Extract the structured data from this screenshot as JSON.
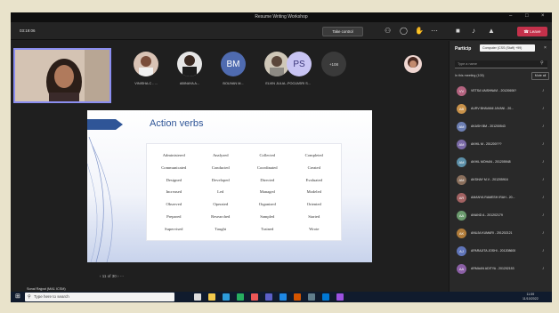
{
  "window": {
    "title": "Resume Writing Workshop"
  },
  "toolbar": {
    "timer": "03:19:06",
    "take_control_label": "Take control",
    "leave_label": "Leave"
  },
  "participants_strip": [
    {
      "initials": "",
      "name": "VINISHA.C - ..."
    },
    {
      "initials": "",
      "name": "ABINAYA A..."
    },
    {
      "initials": "BM",
      "name": "BOUVAN M..."
    },
    {
      "initials": "",
      "name": "ELVIN JULIA..."
    },
    {
      "initials": "PS",
      "name": "POOJASRI S..."
    }
  ],
  "more_count": "+108",
  "slide": {
    "title": "Action verbs",
    "verbs": [
      "Administered",
      "Analyzed",
      "Collected",
      "Completed",
      "Communicated",
      "Conducted",
      "Coordinated",
      "Created",
      "Designed",
      "Developed",
      "Directed",
      "Evaluated",
      "Increased",
      "Led",
      "Managed",
      "Modeled",
      "Observed",
      "Operated",
      "Organized",
      "Oriented",
      "Prepared",
      "Researched",
      "Sampled",
      "Started",
      "Supervised",
      "Taught",
      "Trained",
      "Wrote"
    ],
    "nav": "11 of 30"
  },
  "presenter": "Sonal Rajput (MA1 ICSM)",
  "panel": {
    "title": "Particip",
    "tooltip": "Computer (CSS (Staff) +99)",
    "search_placeholder": "Type a name",
    "section_label": "In this meeting (105)",
    "mute_all_label": "Mute all",
    "people": [
      {
        "initials": "VV",
        "name": "VETSA VAISHNAVI - 20120606?",
        "color": "#b3637f"
      },
      {
        "initials": "AB",
        "name": "AURV BHAVANI JAYANI - 20...",
        "color": "#c9924a"
      },
      {
        "initials": "AM",
        "name": "AKASH BM - 201200543",
        "color": "#6d7fb3"
      },
      {
        "initials": "AM",
        "name": "AKHIL M - 201200???",
        "color": "#7a6aa6"
      },
      {
        "initials": "AM",
        "name": "AKHIL MOHAN - 201205948",
        "color": "#5c8fa8"
      },
      {
        "initials": "AM",
        "name": "AKSHAY M.V - 201205916",
        "color": "#8a6f5c"
      },
      {
        "initials": "AR",
        "name": "AMANYA RAMESH IRAH - 20...",
        "color": "#a26262"
      },
      {
        "initials": "AA",
        "name": "ANAND A - 201202179",
        "color": "#6b9b6e"
      },
      {
        "initials": "AK",
        "name": "ANUJA KUMARI - 201202121",
        "color": "#b07c3a"
      },
      {
        "initials": "AJ",
        "name": "APARAJITA JOSHI - 201208600",
        "color": "#5f74b8"
      },
      {
        "initials": "AA",
        "name": "ARMAAN ADITYA - 201202153",
        "color": "#8b5fa5"
      }
    ]
  },
  "taskbar": {
    "search_placeholder": "Type here to search",
    "time": "11:59",
    "date": "11/10/2022"
  }
}
